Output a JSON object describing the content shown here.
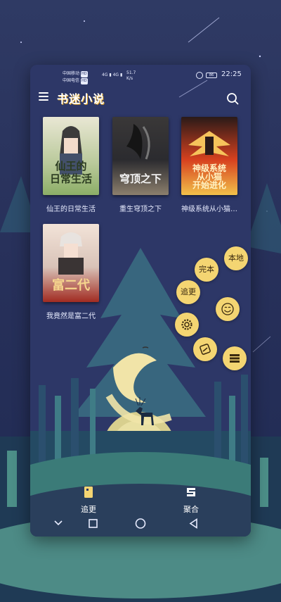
{
  "status_bar": {
    "carrier_1": "中国移动",
    "carrier_2": "中国电信",
    "hd": "HD",
    "signal_1": "4G",
    "signal_2": "4G",
    "net_speed": "51.7",
    "net_unit": "K/s",
    "battery": "86",
    "time": "22:25"
  },
  "app_bar": {
    "title": "书迷小说"
  },
  "books": [
    {
      "title": "仙王的日常生活",
      "cover_text": "仙王的\n日常生活",
      "cover_colors": [
        "#e9e7d4",
        "#8cae67"
      ]
    },
    {
      "title": "重生穹顶之下",
      "cover_text": "穹顶之下",
      "cover_colors": [
        "#2b2b2f",
        "#8c7f6d"
      ]
    },
    {
      "title": "神级系统从小猫…",
      "cover_text": "神级系统\n从小猫\n开始进化",
      "cover_colors": [
        "#d7411f",
        "#f2c14a"
      ]
    },
    {
      "title": "我竟然是富二代",
      "cover_text": "富二代",
      "cover_colors": [
        "#f2e3d8",
        "#a12b21"
      ]
    }
  ],
  "fab_menu": {
    "local_label": "本地",
    "finished_label": "完本",
    "update_label": "追更",
    "settings_icon": "gear-icon",
    "face_icon": "smiley-icon",
    "exit_icon": "exit-icon",
    "list_icon": "list-icon"
  },
  "bottom_nav": {
    "follow_label": "追更",
    "aggregate_label": "聚合"
  },
  "colors": {
    "accent": "#f4d572",
    "background": "#2d3767"
  }
}
